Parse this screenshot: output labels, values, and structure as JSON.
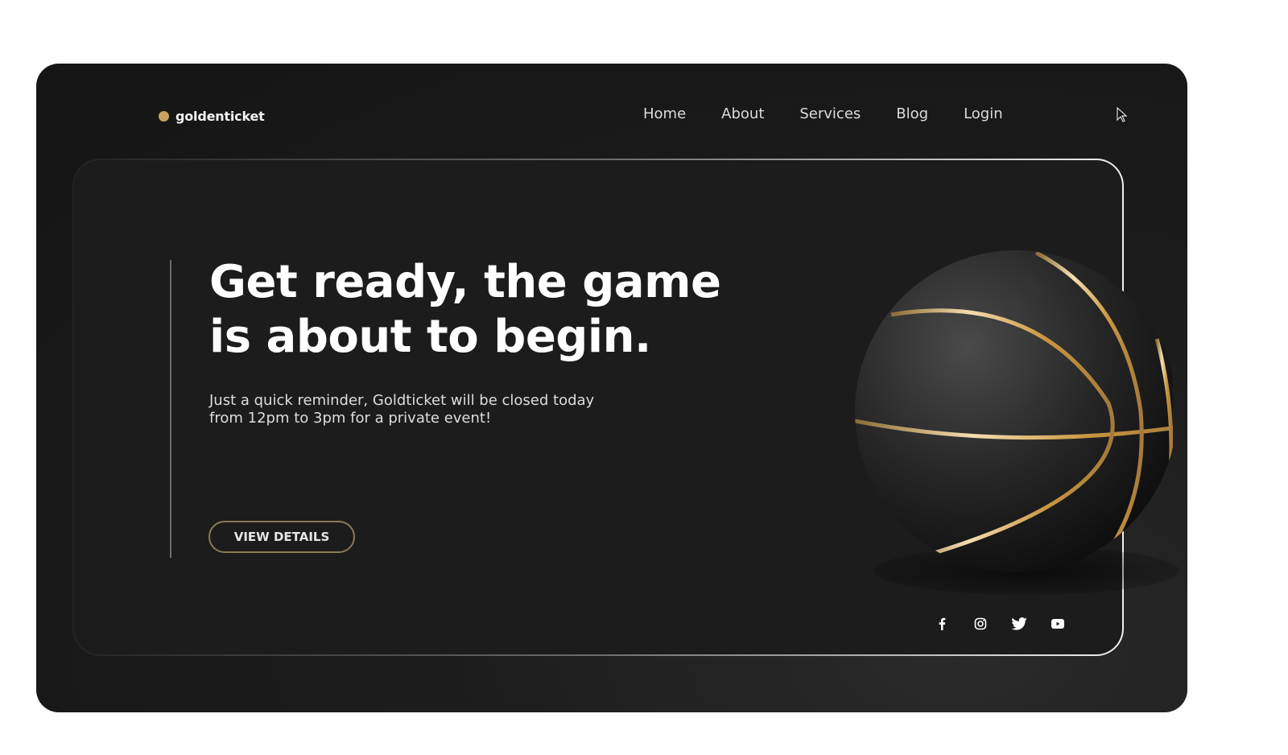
{
  "brand": {
    "name": "goldenticket",
    "accent": "#c9a261"
  },
  "nav": {
    "items": [
      {
        "label": "Home"
      },
      {
        "label": "About"
      },
      {
        "label": "Services"
      },
      {
        "label": "Blog"
      },
      {
        "label": "Login"
      }
    ]
  },
  "hero": {
    "headline_line1": "Get ready, the game",
    "headline_line2": "is about to begin.",
    "subtext_line1": "Just a quick reminder, Goldticket will be closed today",
    "subtext_line2": "from 12pm to 3pm for a private event!",
    "cta_label": "VIEW DETAILS",
    "image": "basketball-black-gold"
  },
  "social": {
    "icons": [
      "facebook-icon",
      "instagram-icon",
      "twitter-icon",
      "youtube-icon"
    ]
  }
}
